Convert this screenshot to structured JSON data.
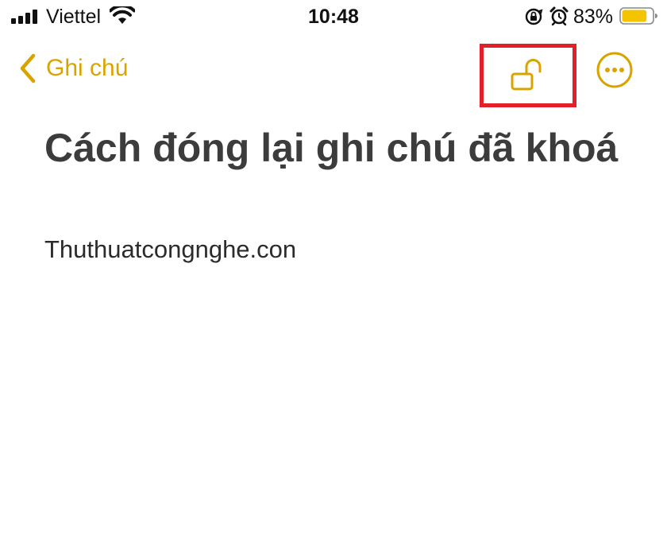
{
  "status_bar": {
    "carrier": "Viettel",
    "time": "10:48",
    "battery_percent": "83%",
    "battery_level": 0.83,
    "battery_color": "#f5c400",
    "icons": [
      "signal-icon",
      "wifi-icon",
      "orientation-lock-icon",
      "alarm-icon",
      "battery-icon"
    ]
  },
  "nav": {
    "back_label": "Ghi chú",
    "accent_color": "#d9a400",
    "lock_icon": "unlocked-padlock-icon",
    "more_icon": "more-options-icon",
    "highlight_color": "#e3202a"
  },
  "note": {
    "title": "Cách đóng lại ghi chú đã khoá",
    "body": "Thuthuatcongnghe.con"
  }
}
